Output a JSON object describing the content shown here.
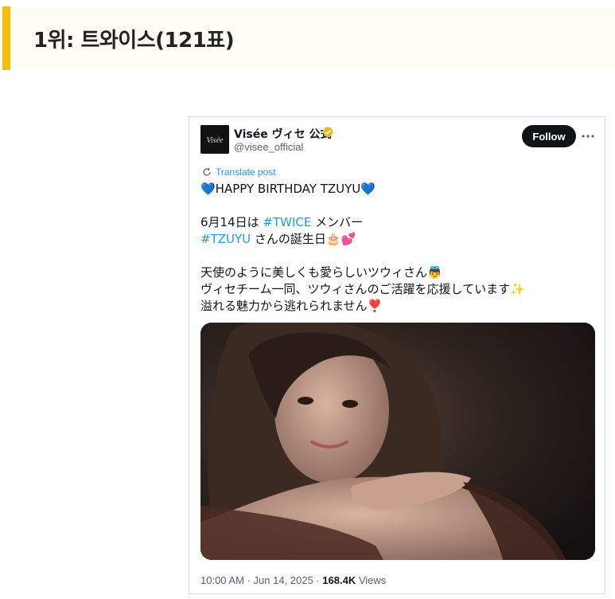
{
  "rank_header": {
    "title": "1위: 트와이스(121표)"
  },
  "tweet": {
    "user": {
      "display_name": "Visée ヴィセ 公式",
      "handle": "@visee_official",
      "avatar_logo_text": "Visée",
      "verified_color": "#e8b923"
    },
    "follow_label": "Follow",
    "translate_label": "Translate post",
    "body": {
      "line1": "💙HAPPY BIRTHDAY TZUYU💙",
      "line2_prefix": "6月14日は ",
      "line2_hashtag": "#TWICE",
      "line2_suffix": " メンバー",
      "line3_hashtag": "#TZUYU",
      "line3_suffix": " さんの誕生日🎂💕",
      "line4": "天使のように美しくも愛らしいツウィさん👼",
      "line5": "ヴィセチーム一同、ツウィさんのご活躍を応援しています✨",
      "line6": "溢れる魅力から逃れられません❣️"
    },
    "image_alt_icon": "portrait-photo",
    "meta": {
      "time": "10:00 AM",
      "date": "Jun 14, 2025",
      "views_count": "168.4K",
      "views_label": "Views"
    },
    "colors": {
      "link": "#1d9bf0",
      "follow_bg": "#0f1419",
      "accent_bar": "#f5c000"
    }
  }
}
